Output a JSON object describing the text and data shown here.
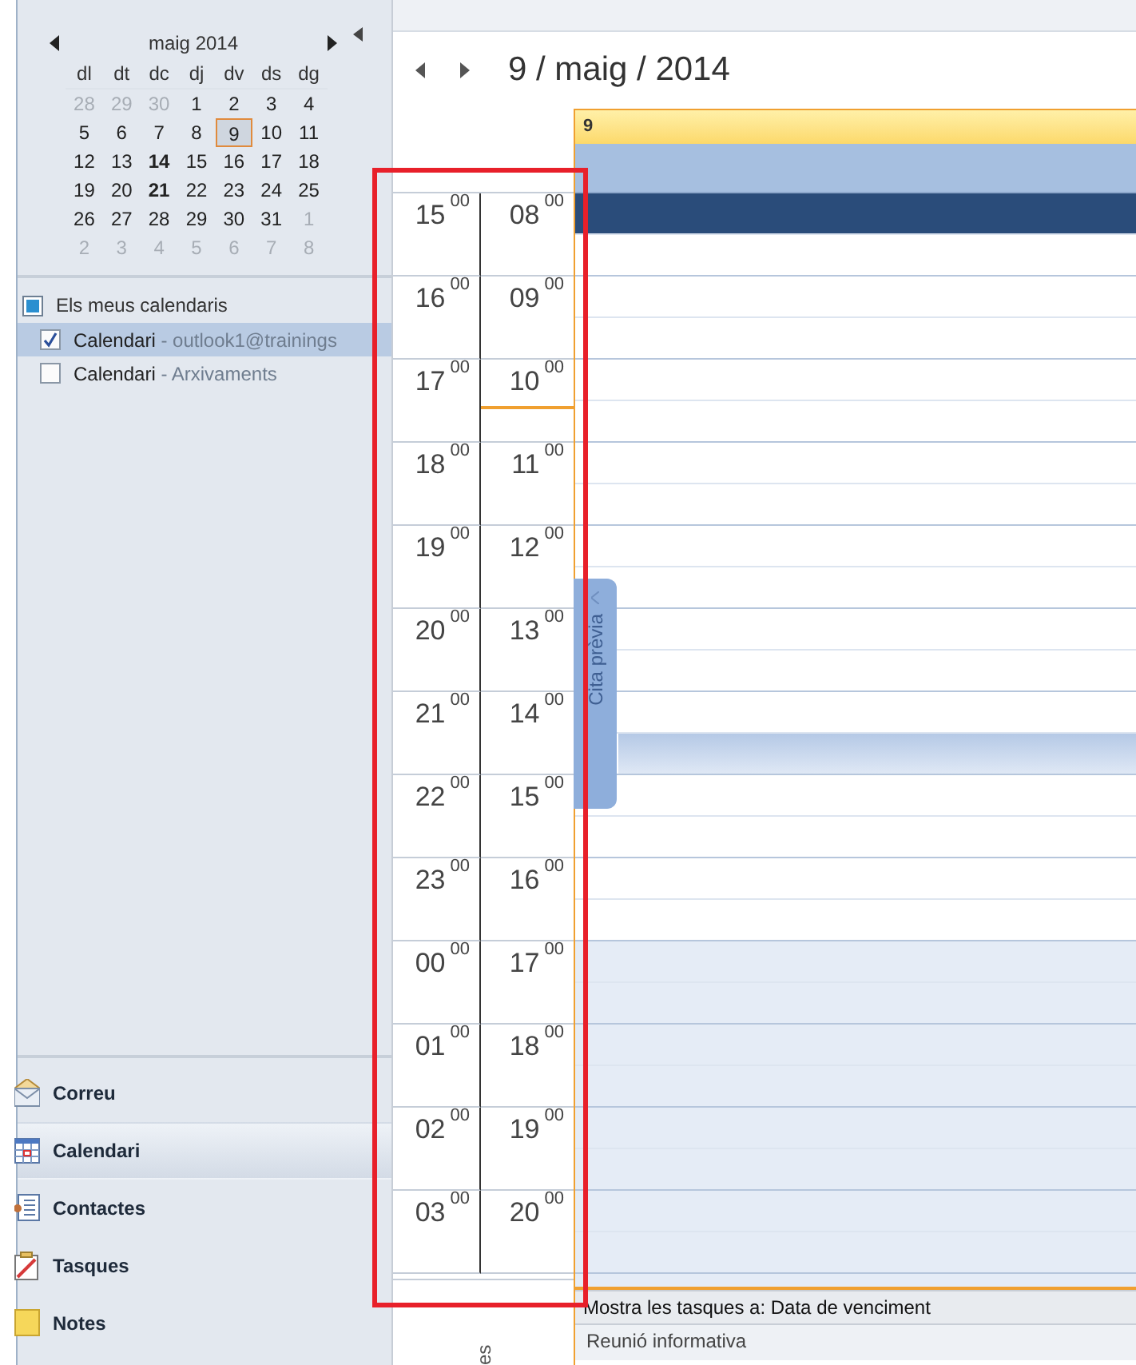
{
  "mini_calendar": {
    "month": "maig 2014",
    "weekdays": [
      "dl",
      "dt",
      "dc",
      "dj",
      "dv",
      "ds",
      "dg"
    ],
    "days": [
      {
        "label": "28",
        "other_month": true,
        "bold": false,
        "selected": false
      },
      {
        "label": "29",
        "other_month": true,
        "bold": false,
        "selected": false
      },
      {
        "label": "30",
        "other_month": true,
        "bold": false,
        "selected": false
      },
      {
        "label": "1",
        "other_month": false,
        "bold": false,
        "selected": false
      },
      {
        "label": "2",
        "other_month": false,
        "bold": false,
        "selected": false
      },
      {
        "label": "3",
        "other_month": false,
        "bold": false,
        "selected": false
      },
      {
        "label": "4",
        "other_month": false,
        "bold": false,
        "selected": false
      },
      {
        "label": "5",
        "other_month": false,
        "bold": false,
        "selected": false
      },
      {
        "label": "6",
        "other_month": false,
        "bold": false,
        "selected": false
      },
      {
        "label": "7",
        "other_month": false,
        "bold": false,
        "selected": false
      },
      {
        "label": "8",
        "other_month": false,
        "bold": false,
        "selected": false
      },
      {
        "label": "9",
        "other_month": false,
        "bold": false,
        "selected": true
      },
      {
        "label": "10",
        "other_month": false,
        "bold": false,
        "selected": false
      },
      {
        "label": "11",
        "other_month": false,
        "bold": false,
        "selected": false
      },
      {
        "label": "12",
        "other_month": false,
        "bold": false,
        "selected": false
      },
      {
        "label": "13",
        "other_month": false,
        "bold": false,
        "selected": false
      },
      {
        "label": "14",
        "other_month": false,
        "bold": true,
        "selected": false
      },
      {
        "label": "15",
        "other_month": false,
        "bold": false,
        "selected": false
      },
      {
        "label": "16",
        "other_month": false,
        "bold": false,
        "selected": false
      },
      {
        "label": "17",
        "other_month": false,
        "bold": false,
        "selected": false
      },
      {
        "label": "18",
        "other_month": false,
        "bold": false,
        "selected": false
      },
      {
        "label": "19",
        "other_month": false,
        "bold": false,
        "selected": false
      },
      {
        "label": "20",
        "other_month": false,
        "bold": false,
        "selected": false
      },
      {
        "label": "21",
        "other_month": false,
        "bold": true,
        "selected": false
      },
      {
        "label": "22",
        "other_month": false,
        "bold": false,
        "selected": false
      },
      {
        "label": "23",
        "other_month": false,
        "bold": false,
        "selected": false
      },
      {
        "label": "24",
        "other_month": false,
        "bold": false,
        "selected": false
      },
      {
        "label": "25",
        "other_month": false,
        "bold": false,
        "selected": false
      },
      {
        "label": "26",
        "other_month": false,
        "bold": false,
        "selected": false
      },
      {
        "label": "27",
        "other_month": false,
        "bold": false,
        "selected": false
      },
      {
        "label": "28",
        "other_month": false,
        "bold": false,
        "selected": false
      },
      {
        "label": "29",
        "other_month": false,
        "bold": false,
        "selected": false
      },
      {
        "label": "30",
        "other_month": false,
        "bold": false,
        "selected": false
      },
      {
        "label": "31",
        "other_month": false,
        "bold": false,
        "selected": false
      },
      {
        "label": "1",
        "other_month": true,
        "bold": false,
        "selected": false
      },
      {
        "label": "2",
        "other_month": true,
        "bold": false,
        "selected": false
      },
      {
        "label": "3",
        "other_month": true,
        "bold": false,
        "selected": false
      },
      {
        "label": "4",
        "other_month": true,
        "bold": false,
        "selected": false
      },
      {
        "label": "5",
        "other_month": true,
        "bold": false,
        "selected": false
      },
      {
        "label": "6",
        "other_month": true,
        "bold": false,
        "selected": false
      },
      {
        "label": "7",
        "other_month": true,
        "bold": false,
        "selected": false
      },
      {
        "label": "8",
        "other_month": true,
        "bold": false,
        "selected": false
      }
    ]
  },
  "calendar_group": {
    "title": "Els meus calendaris",
    "items": [
      {
        "name": "Calendari",
        "detail": "- outlook1@trainings",
        "checked": true,
        "selected": true
      },
      {
        "name": "Calendari",
        "detail": "- Arxivaments",
        "checked": false,
        "selected": false
      }
    ]
  },
  "navigation": [
    {
      "kind": "mail",
      "label": "Correu",
      "selected": false
    },
    {
      "kind": "calendar",
      "label": "Calendari",
      "selected": true
    },
    {
      "kind": "contacts",
      "label": "Contactes",
      "selected": false
    },
    {
      "kind": "tasks",
      "label": "Tasques",
      "selected": false
    },
    {
      "kind": "notes",
      "label": "Notes",
      "selected": false
    }
  ],
  "date_title": "9 / maig / 2014",
  "day_header": "9",
  "rows": [
    {
      "left": {
        "hour": "15",
        "minutes": "00"
      },
      "right": {
        "hour": "08",
        "minutes": "00"
      },
      "working": true,
      "now_marker": false,
      "halves": [
        {
          "kind": "selected"
        },
        {
          "kind": "free"
        }
      ]
    },
    {
      "left": {
        "hour": "16",
        "minutes": "00"
      },
      "right": {
        "hour": "09",
        "minutes": "00"
      },
      "working": true,
      "now_marker": false,
      "halves": [
        {
          "kind": "free"
        },
        {
          "kind": "free"
        }
      ]
    },
    {
      "left": {
        "hour": "17",
        "minutes": "00"
      },
      "right": {
        "hour": "10",
        "minutes": "00"
      },
      "working": true,
      "now_marker": true,
      "halves": [
        {
          "kind": "free"
        },
        {
          "kind": "free"
        }
      ]
    },
    {
      "left": {
        "hour": "18",
        "minutes": "00"
      },
      "right": {
        "hour": "11",
        "minutes": "00"
      },
      "working": true,
      "now_marker": false,
      "halves": [
        {
          "kind": "free"
        },
        {
          "kind": "free"
        }
      ]
    },
    {
      "left": {
        "hour": "19",
        "minutes": "00"
      },
      "right": {
        "hour": "12",
        "minutes": "00"
      },
      "working": true,
      "now_marker": false,
      "halves": [
        {
          "kind": "free"
        },
        {
          "kind": "free"
        }
      ]
    },
    {
      "left": {
        "hour": "20",
        "minutes": "00"
      },
      "right": {
        "hour": "13",
        "minutes": "00"
      },
      "working": true,
      "now_marker": false,
      "halves": [
        {
          "kind": "free"
        },
        {
          "kind": "free"
        }
      ]
    },
    {
      "left": {
        "hour": "21",
        "minutes": "00"
      },
      "right": {
        "hour": "14",
        "minutes": "00"
      },
      "working": true,
      "now_marker": false,
      "halves": [
        {
          "kind": "free"
        },
        {
          "kind": "appointment"
        }
      ]
    },
    {
      "left": {
        "hour": "22",
        "minutes": "00"
      },
      "right": {
        "hour": "15",
        "minutes": "00"
      },
      "working": true,
      "now_marker": false,
      "halves": [
        {
          "kind": "free"
        },
        {
          "kind": "free"
        }
      ]
    },
    {
      "left": {
        "hour": "23",
        "minutes": "00"
      },
      "right": {
        "hour": "16",
        "minutes": "00"
      },
      "working": true,
      "now_marker": false,
      "halves": [
        {
          "kind": "free"
        },
        {
          "kind": "free"
        }
      ]
    },
    {
      "left": {
        "hour": "00",
        "minutes": "00"
      },
      "right": {
        "hour": "17",
        "minutes": "00"
      },
      "working": false,
      "now_marker": false,
      "halves": [
        {
          "kind": "free"
        },
        {
          "kind": "free"
        }
      ]
    },
    {
      "left": {
        "hour": "01",
        "minutes": "00"
      },
      "right": {
        "hour": "18",
        "minutes": "00"
      },
      "working": false,
      "now_marker": false,
      "halves": [
        {
          "kind": "free"
        },
        {
          "kind": "free"
        }
      ]
    },
    {
      "left": {
        "hour": "02",
        "minutes": "00"
      },
      "right": {
        "hour": "19",
        "minutes": "00"
      },
      "working": false,
      "now_marker": false,
      "halves": [
        {
          "kind": "free"
        },
        {
          "kind": "free"
        }
      ]
    },
    {
      "left": {
        "hour": "03",
        "minutes": "00"
      },
      "right": {
        "hour": "20",
        "minutes": "00"
      },
      "working": false,
      "now_marker": false,
      "halves": [
        {
          "kind": "free"
        },
        {
          "kind": "free"
        }
      ]
    }
  ],
  "side_tab": "Cita prèvia",
  "tasks_area": {
    "vertical_label": "es",
    "header": "Mostra les tasques a: Data de venciment",
    "items": [
      "Reunió informativa"
    ]
  },
  "annotation": {
    "kind": "highlight-rectangle"
  }
}
